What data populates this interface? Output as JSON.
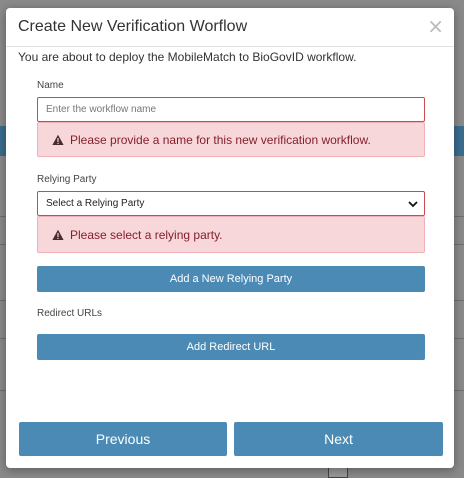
{
  "modal": {
    "title": "Create New Verification Worflow",
    "close_symbol": "×",
    "intro": "You are about to deploy the MobileMatch to BioGovID workflow."
  },
  "name_field": {
    "label": "Name",
    "value": "",
    "placeholder": "Enter the workflow name",
    "error": "Please provide a name for this new verification workflow."
  },
  "relying_party": {
    "label": "Relying Party",
    "selected": "Select a Relying Party",
    "error": "Please select a relying party.",
    "add_button": "Add a New Relying Party"
  },
  "redirect": {
    "label": "Redirect URLs",
    "add_button": "Add Redirect URL"
  },
  "footer": {
    "previous": "Previous",
    "next": "Next"
  },
  "icons": {
    "warning": "warning-triangle-icon",
    "dropdown": "chevron-down-icon",
    "close": "close-icon"
  },
  "colors": {
    "primary": "#4a8ab5",
    "error_border": "#c94a4f",
    "alert_bg": "#f8d7da",
    "alert_text": "#842029"
  }
}
